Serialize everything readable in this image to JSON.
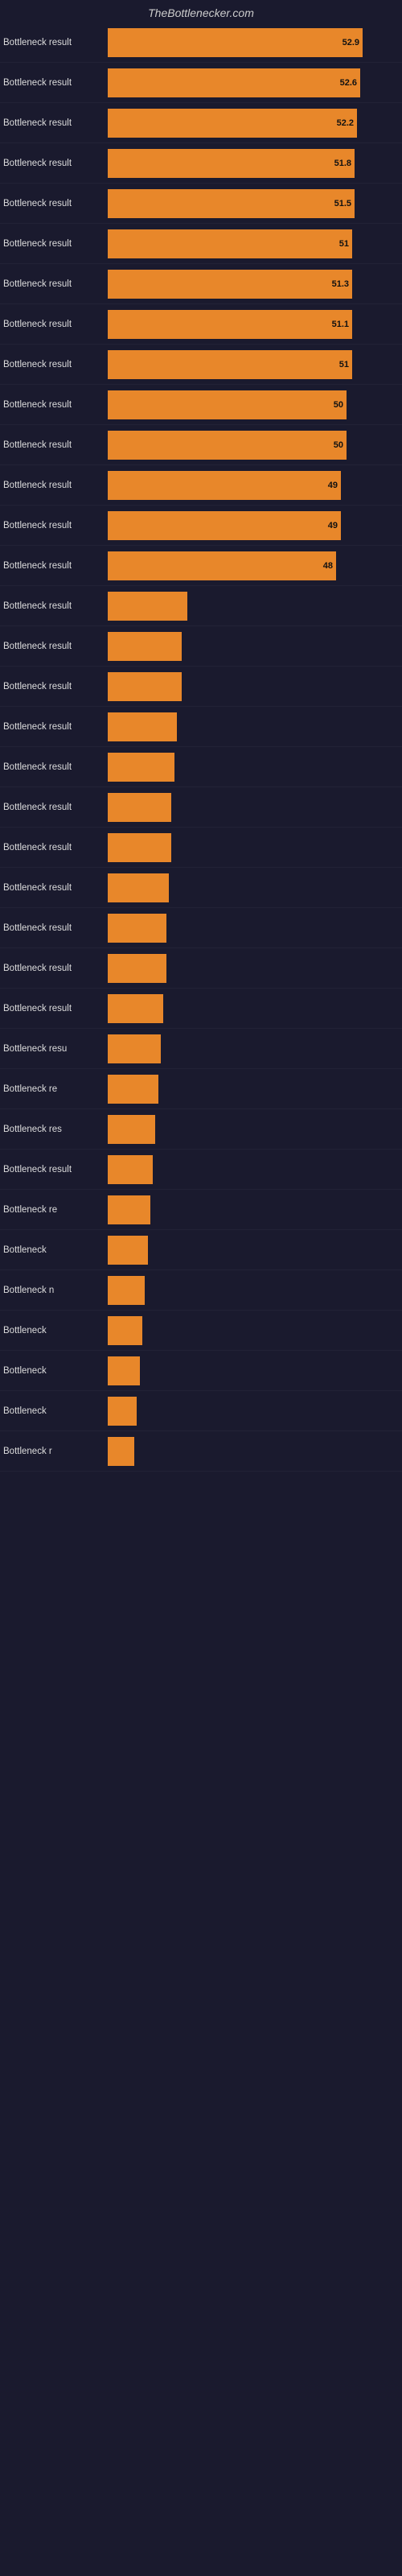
{
  "header": {
    "title": "TheBottlenecker.com"
  },
  "entries": [
    {
      "label": "Bottleneck result",
      "value": "52.9",
      "bar_pct": 96
    },
    {
      "label": "Bottleneck result",
      "value": "52.6",
      "bar_pct": 95
    },
    {
      "label": "Bottleneck result",
      "value": "52.2",
      "bar_pct": 94
    },
    {
      "label": "Bottleneck result",
      "value": "51.8",
      "bar_pct": 93
    },
    {
      "label": "Bottleneck result",
      "value": "51.5",
      "bar_pct": 93
    },
    {
      "label": "Bottleneck result",
      "value": "51",
      "bar_pct": 92
    },
    {
      "label": "Bottleneck result",
      "value": "51.3",
      "bar_pct": 92
    },
    {
      "label": "Bottleneck result",
      "value": "51.1",
      "bar_pct": 92
    },
    {
      "label": "Bottleneck result",
      "value": "51",
      "bar_pct": 92
    },
    {
      "label": "Bottleneck result",
      "value": "50",
      "bar_pct": 90
    },
    {
      "label": "Bottleneck result",
      "value": "50",
      "bar_pct": 90
    },
    {
      "label": "Bottleneck result",
      "value": "49",
      "bar_pct": 88
    },
    {
      "label": "Bottleneck result",
      "value": "49",
      "bar_pct": 88
    },
    {
      "label": "Bottleneck result",
      "value": "48",
      "bar_pct": 86
    },
    {
      "label": "Bottleneck result",
      "value": "",
      "bar_pct": 30
    },
    {
      "label": "Bottleneck result",
      "value": "",
      "bar_pct": 28
    },
    {
      "label": "Bottleneck result",
      "value": "",
      "bar_pct": 28
    },
    {
      "label": "Bottleneck result",
      "value": "",
      "bar_pct": 26
    },
    {
      "label": "Bottleneck result",
      "value": "",
      "bar_pct": 25
    },
    {
      "label": "Bottleneck result",
      "value": "",
      "bar_pct": 24
    },
    {
      "label": "Bottleneck result",
      "value": "",
      "bar_pct": 24
    },
    {
      "label": "Bottleneck result",
      "value": "",
      "bar_pct": 23
    },
    {
      "label": "Bottleneck result",
      "value": "",
      "bar_pct": 22
    },
    {
      "label": "Bottleneck result",
      "value": "",
      "bar_pct": 22
    },
    {
      "label": "Bottleneck result",
      "value": "",
      "bar_pct": 21
    },
    {
      "label": "Bottleneck resu",
      "value": "",
      "bar_pct": 20
    },
    {
      "label": "Bottleneck re",
      "value": "",
      "bar_pct": 19
    },
    {
      "label": "Bottleneck res",
      "value": "",
      "bar_pct": 18
    },
    {
      "label": "Bottleneck result",
      "value": "",
      "bar_pct": 17
    },
    {
      "label": "Bottleneck re",
      "value": "",
      "bar_pct": 16
    },
    {
      "label": "Bottleneck",
      "value": "",
      "bar_pct": 15
    },
    {
      "label": "Bottleneck n",
      "value": "",
      "bar_pct": 14
    },
    {
      "label": "Bottleneck",
      "value": "",
      "bar_pct": 13
    },
    {
      "label": "Bottleneck",
      "value": "",
      "bar_pct": 12
    },
    {
      "label": "Bottleneck",
      "value": "",
      "bar_pct": 11
    },
    {
      "label": "Bottleneck r",
      "value": "",
      "bar_pct": 10
    }
  ]
}
